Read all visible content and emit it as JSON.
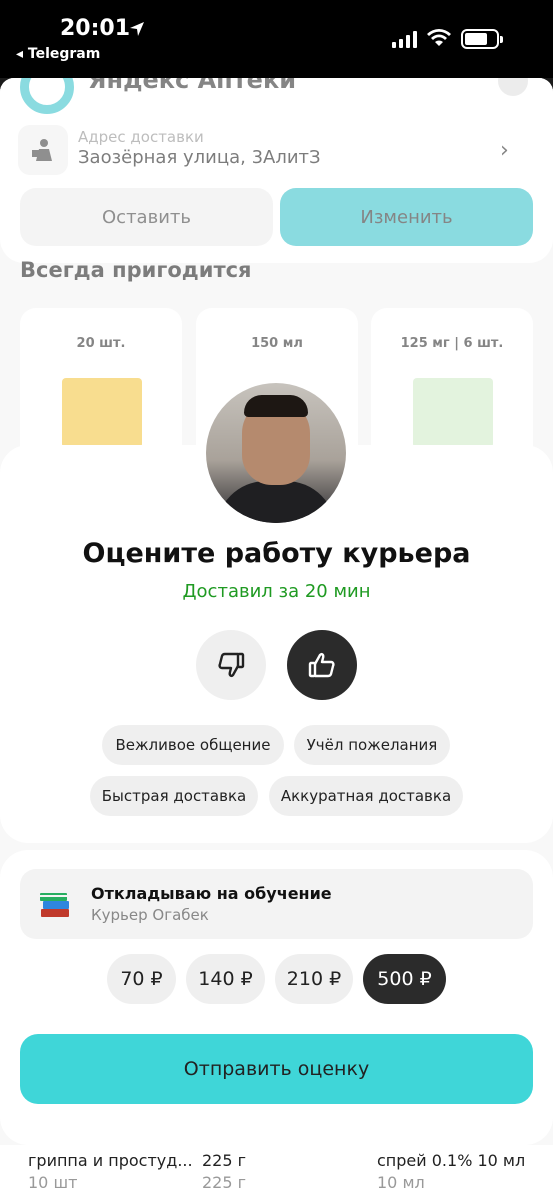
{
  "status_bar": {
    "time": "20:01",
    "back_app": "◂ Telegram"
  },
  "background": {
    "app_title": "Яндекс Аптеки",
    "address_label": "Адрес доставки",
    "address_value": "Заозёрная улица, 3АлитЗ",
    "leave_button": "Оставить",
    "change_button": "Изменить",
    "section_title": "Всегда пригодится",
    "product_tags": [
      "20 шт.",
      "150 мл",
      "125 мг | 6 шт."
    ],
    "bottom_products": [
      {
        "name": "гриппа и простуд...",
        "sub": "10 шт"
      },
      {
        "name": "225 г",
        "sub": "225 г"
      },
      {
        "name": "спрей 0.1% 10 мл",
        "sub": "10 мл"
      }
    ]
  },
  "rating": {
    "title": "Оцените работу курьера",
    "subtitle": "Доставил за 20 мин",
    "chips": [
      "Вежливое общение",
      "Учёл пожелания",
      "Быстрая доставка",
      "Аккуратная доставка"
    ]
  },
  "tip": {
    "title": "Откладываю на обучение",
    "courier": "Курьер Огабек",
    "amounts": [
      "70 ₽",
      "140 ₽",
      "210 ₽",
      "500 ₽"
    ],
    "selected_amount": "500 ₽"
  },
  "submit_button": "Отправить оценку",
  "colors": {
    "accent": "#3fd6d8",
    "success": "#1f9a22",
    "dark": "#2b2b2b"
  }
}
